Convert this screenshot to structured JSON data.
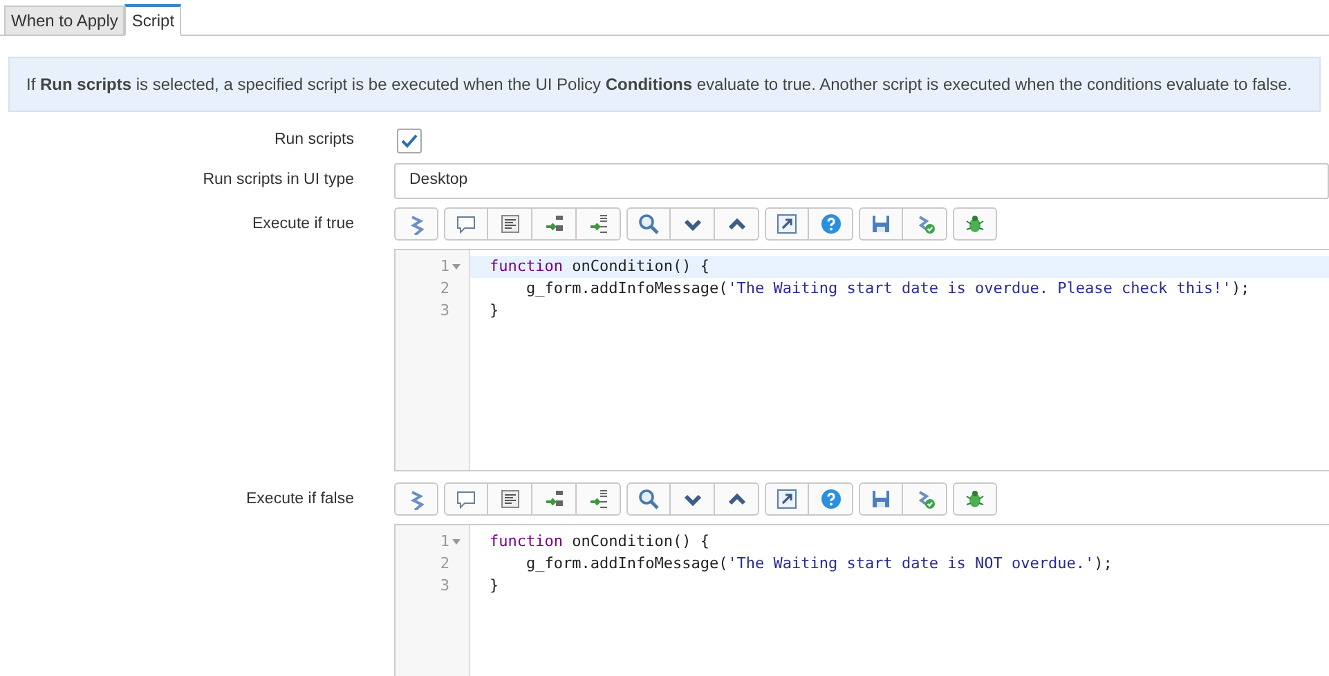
{
  "tabs": [
    {
      "label": "When to Apply",
      "selected": false
    },
    {
      "label": "Script",
      "selected": true
    }
  ],
  "info": "If **Run scripts** is selected, a specified script is be executed when the UI Policy **Conditions** evaluate to true. Another script is executed when the conditions evaluate to false.",
  "fields": [
    {
      "kind": "checkbox",
      "label": "Run scripts",
      "checked": true
    },
    {
      "kind": "text",
      "label": "Run scripts in UI type",
      "value": "Desktop"
    },
    {
      "kind": "editor",
      "label": "Execute if true",
      "lines": [
        {
          "number": "1",
          "foldable": true,
          "active": true,
          "tokens": [
            {
              "kind": "keyword",
              "text": "function"
            },
            {
              "kind": "plain",
              "text": " onCondition() {"
            }
          ]
        },
        {
          "number": "2",
          "foldable": false,
          "active": false,
          "tokens": [
            {
              "kind": "plain",
              "text": "    g_form.addInfoMessage("
            },
            {
              "kind": "string",
              "text": "'The Waiting start date is overdue. Please check this!'"
            },
            {
              "kind": "plain",
              "text": ");"
            }
          ]
        },
        {
          "number": "3",
          "foldable": false,
          "active": false,
          "tokens": [
            {
              "kind": "plain",
              "text": "}"
            }
          ]
        }
      ]
    },
    {
      "kind": "editor",
      "label": "Execute if false",
      "lines": [
        {
          "number": "1",
          "foldable": true,
          "active": false,
          "tokens": [
            {
              "kind": "keyword",
              "text": "function"
            },
            {
              "kind": "plain",
              "text": " onCondition() {"
            }
          ]
        },
        {
          "number": "2",
          "foldable": false,
          "active": false,
          "tokens": [
            {
              "kind": "plain",
              "text": "    g_form.addInfoMessage("
            },
            {
              "kind": "string",
              "text": "'The Waiting start date is NOT overdue.'"
            },
            {
              "kind": "plain",
              "text": ");"
            }
          ]
        },
        {
          "number": "3",
          "foldable": false,
          "active": false,
          "tokens": [
            {
              "kind": "plain",
              "text": "}"
            }
          ]
        }
      ]
    }
  ]
}
